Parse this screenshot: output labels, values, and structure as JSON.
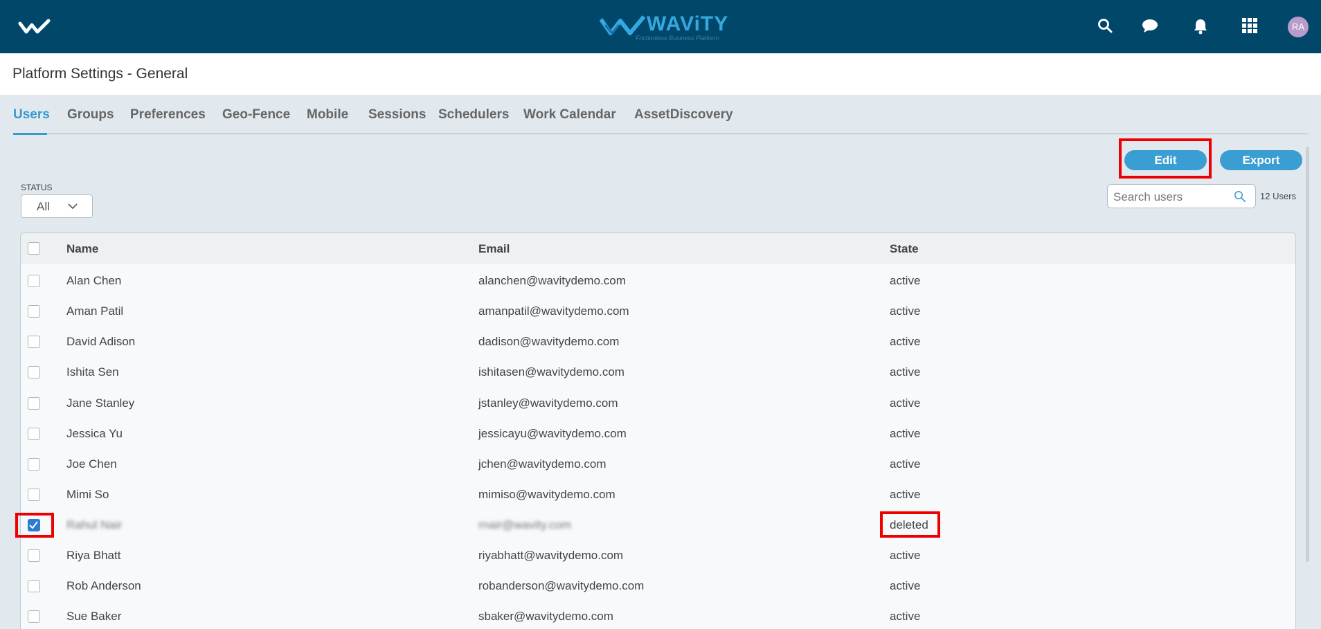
{
  "header": {
    "brand_name": "WAViTY",
    "brand_tagline": "Frictionless Business Platform",
    "avatar_initials": "RA",
    "colors": {
      "header_bg": "#00476a",
      "accent": "#3b9ed3"
    }
  },
  "page": {
    "title": "Platform Settings - General"
  },
  "tabs": [
    {
      "label": "Users",
      "active": true
    },
    {
      "label": "Groups"
    },
    {
      "label": "Preferences"
    },
    {
      "label": "Geo-Fence"
    },
    {
      "label": "Mobile"
    },
    {
      "label": "Sessions"
    },
    {
      "label": "Schedulers"
    },
    {
      "label": "Work Calendar"
    },
    {
      "label": "AssetDiscovery"
    }
  ],
  "toolbar": {
    "edit_label": "Edit",
    "export_label": "Export"
  },
  "filter": {
    "status_label": "STATUS",
    "status_value": "All"
  },
  "search": {
    "placeholder": "Search users",
    "count_label": "12 Users"
  },
  "table": {
    "columns": [
      "Name",
      "Email",
      "State"
    ],
    "rows": [
      {
        "name": "Alan Chen",
        "email": "alanchen@wavitydemo.com",
        "state": "active",
        "checked": false
      },
      {
        "name": "Aman Patil",
        "email": "amanpatil@wavitydemo.com",
        "state": "active",
        "checked": false
      },
      {
        "name": "David Adison",
        "email": "dadison@wavitydemo.com",
        "state": "active",
        "checked": false
      },
      {
        "name": "Ishita Sen",
        "email": "ishitasen@wavitydemo.com",
        "state": "active",
        "checked": false
      },
      {
        "name": "Jane Stanley",
        "email": "jstanley@wavitydemo.com",
        "state": "active",
        "checked": false
      },
      {
        "name": "Jessica Yu",
        "email": "jessicayu@wavitydemo.com",
        "state": "active",
        "checked": false
      },
      {
        "name": "Joe Chen",
        "email": "jchen@wavitydemo.com",
        "state": "active",
        "checked": false
      },
      {
        "name": "Mimi So",
        "email": "mimiso@wavitydemo.com",
        "state": "active",
        "checked": false
      },
      {
        "name": "Rahul Nair",
        "email": "rnair@wavity.com",
        "state": "deleted",
        "checked": true,
        "blurred": true
      },
      {
        "name": "Riya Bhatt",
        "email": "riyabhatt@wavitydemo.com",
        "state": "active",
        "checked": false
      },
      {
        "name": "Rob Anderson",
        "email": "robanderson@wavitydemo.com",
        "state": "active",
        "checked": false
      },
      {
        "name": "Sue Baker",
        "email": "sbaker@wavitydemo.com",
        "state": "active",
        "checked": false
      }
    ]
  }
}
